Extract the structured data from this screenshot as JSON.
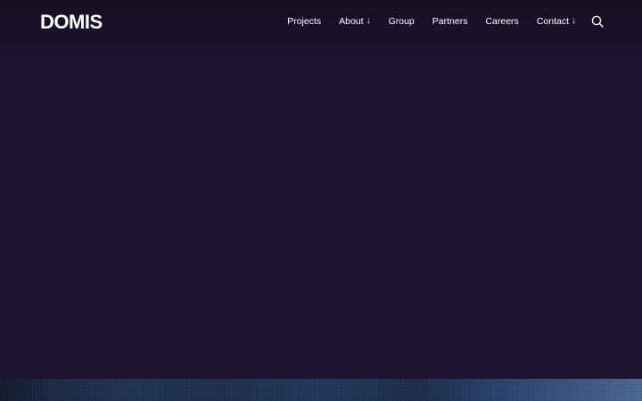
{
  "brand": {
    "logo_text": "DOMIS"
  },
  "nav": {
    "items": [
      {
        "label": "Projects",
        "has_dropdown": false
      },
      {
        "label": "About",
        "has_dropdown": true,
        "arrow": "↓"
      },
      {
        "label": "Group",
        "has_dropdown": false
      },
      {
        "label": "Partners",
        "has_dropdown": false
      },
      {
        "label": "Careers",
        "has_dropdown": false
      },
      {
        "label": "Contact",
        "has_dropdown": true,
        "arrow": "↓"
      }
    ],
    "search_icon": "search-icon"
  },
  "colors": {
    "background": "#1b1430",
    "header_top": "#140f22",
    "text": "#ffffff",
    "hero_image_tone": "#223a60"
  }
}
